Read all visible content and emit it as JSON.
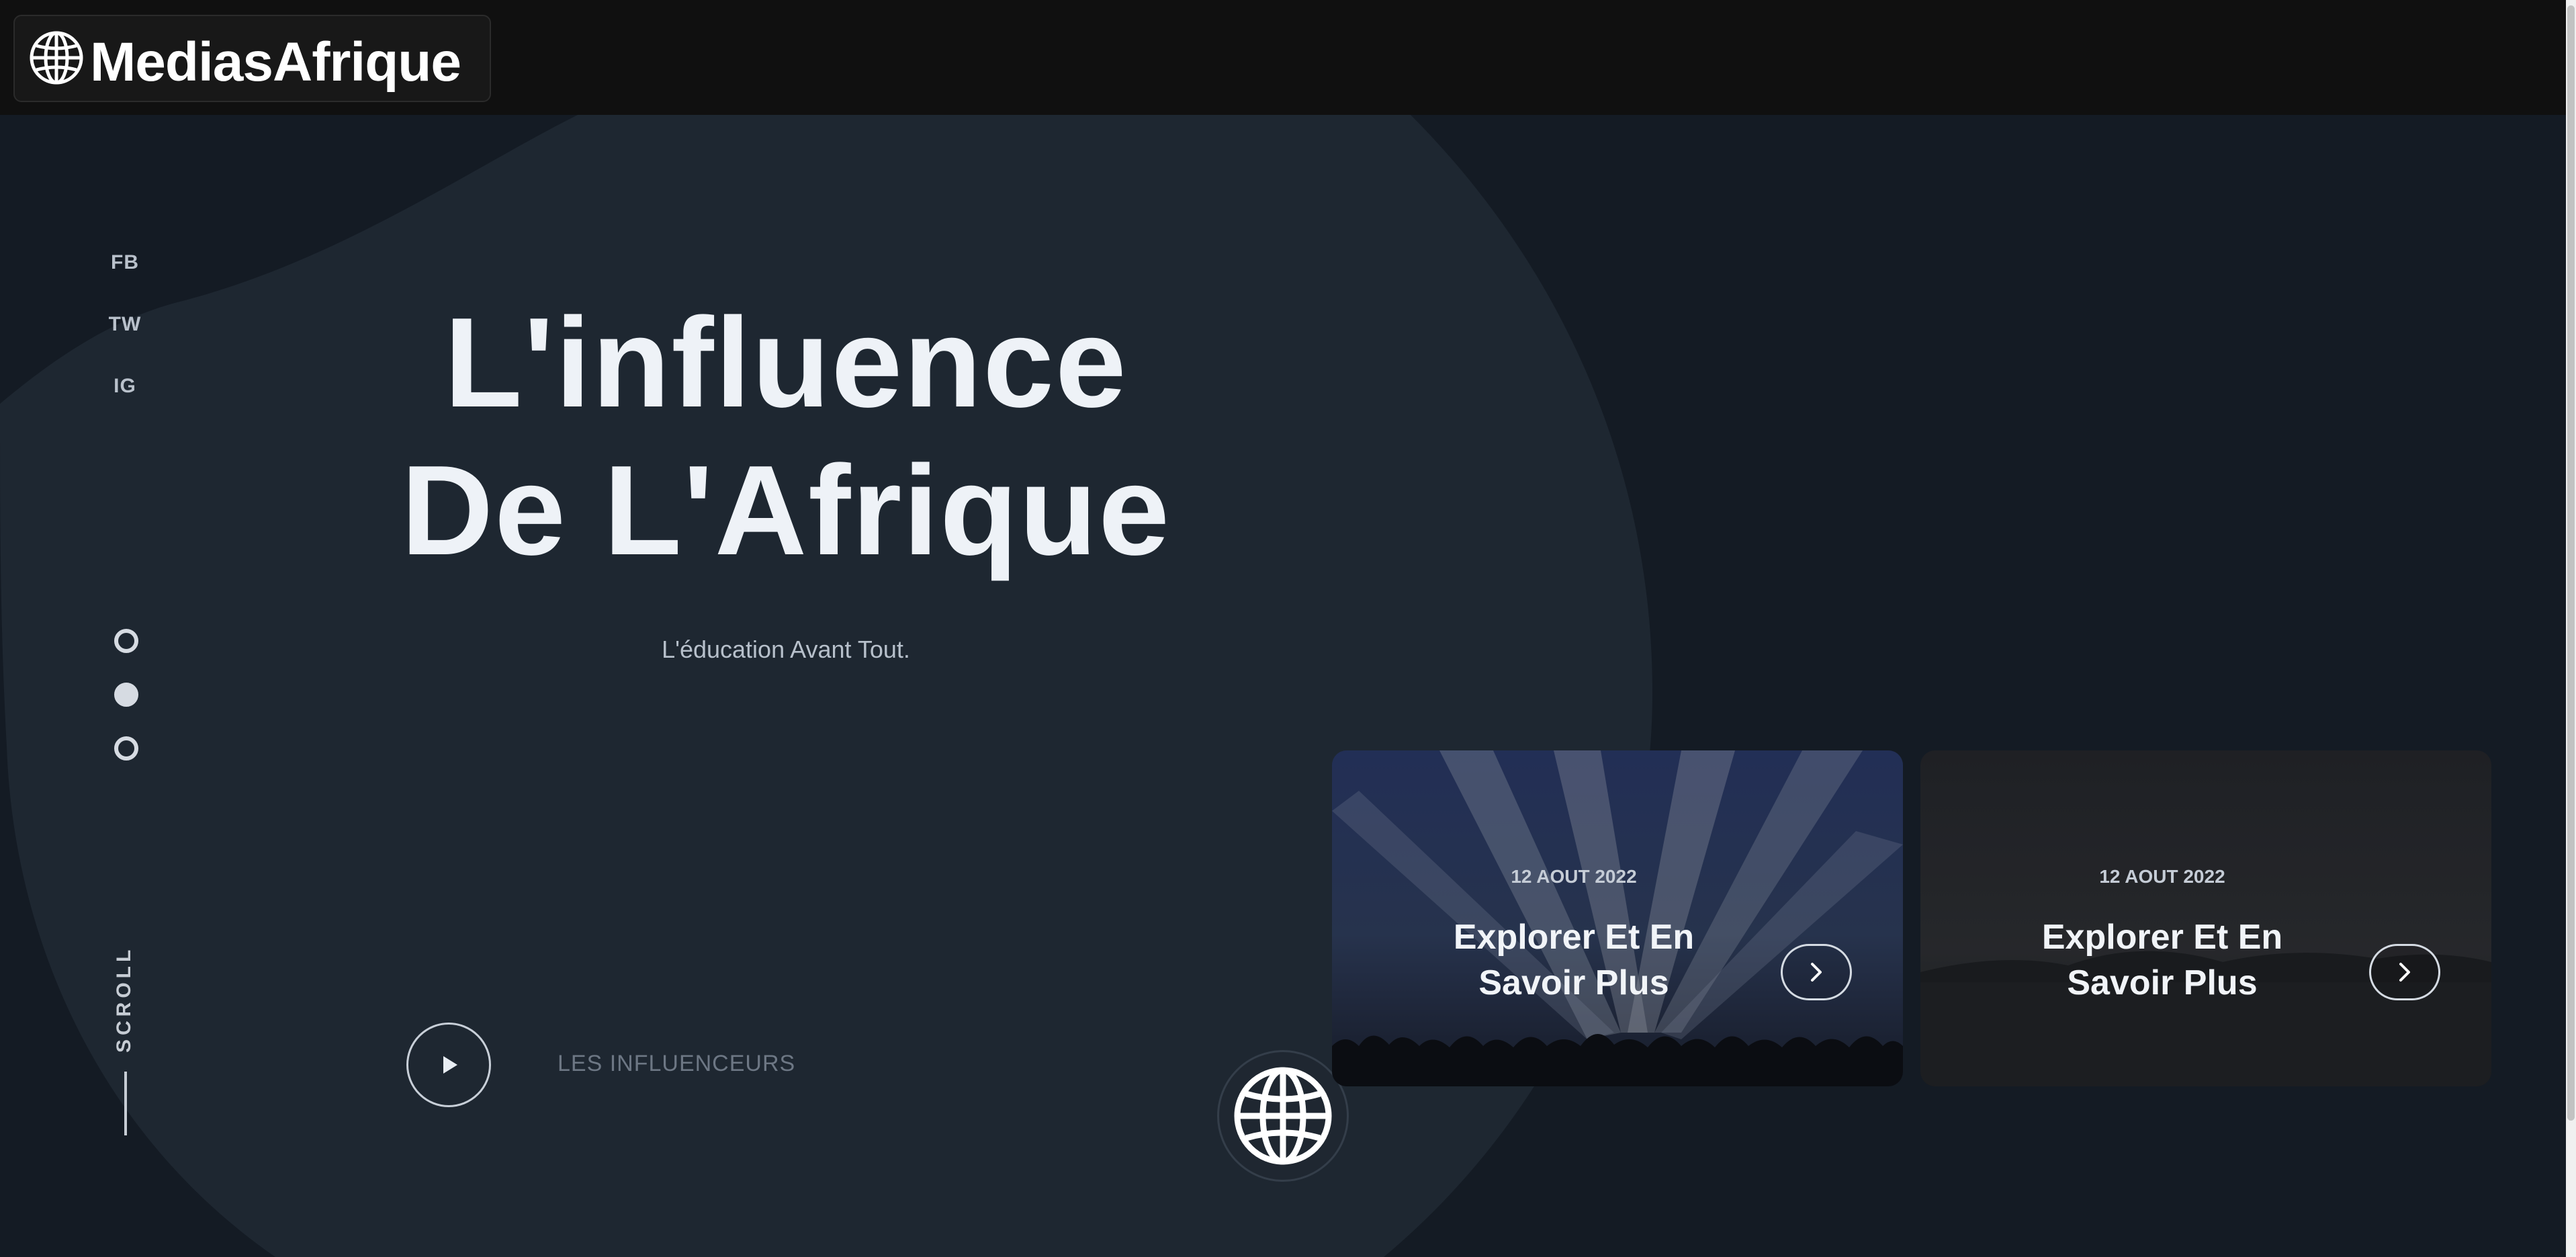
{
  "header": {
    "brand_name": "MediasAfrique",
    "brand_icon": "globe-icon"
  },
  "social": {
    "items": [
      "FB",
      "TW",
      "IG"
    ]
  },
  "slider": {
    "dots": 3,
    "active_index": 1
  },
  "scroll": {
    "label": "SCROLL"
  },
  "hero": {
    "title_line1": "L'influence",
    "title_line2": "De L'Afrique",
    "subtitle": "L'éducation Avant Tout.",
    "play_icon": "play-icon",
    "play_label": "LES INFLUENCEURS"
  },
  "center_badge": {
    "icon": "globe-icon"
  },
  "cards": [
    {
      "date": "12 AOUT 2022",
      "title_line1": "Explorer Et En",
      "title_line2": "Savoir Plus",
      "arrow_icon": "chevron-right-icon"
    },
    {
      "date": "12 AOUT 2022",
      "title_line1": "Explorer Et En",
      "title_line2": "Savoir Plus",
      "arrow_icon": "chevron-right-icon"
    }
  ],
  "colors": {
    "background": "#141b24",
    "blob": "#1e2731",
    "header": "#101010",
    "text": "#eef2f7"
  }
}
